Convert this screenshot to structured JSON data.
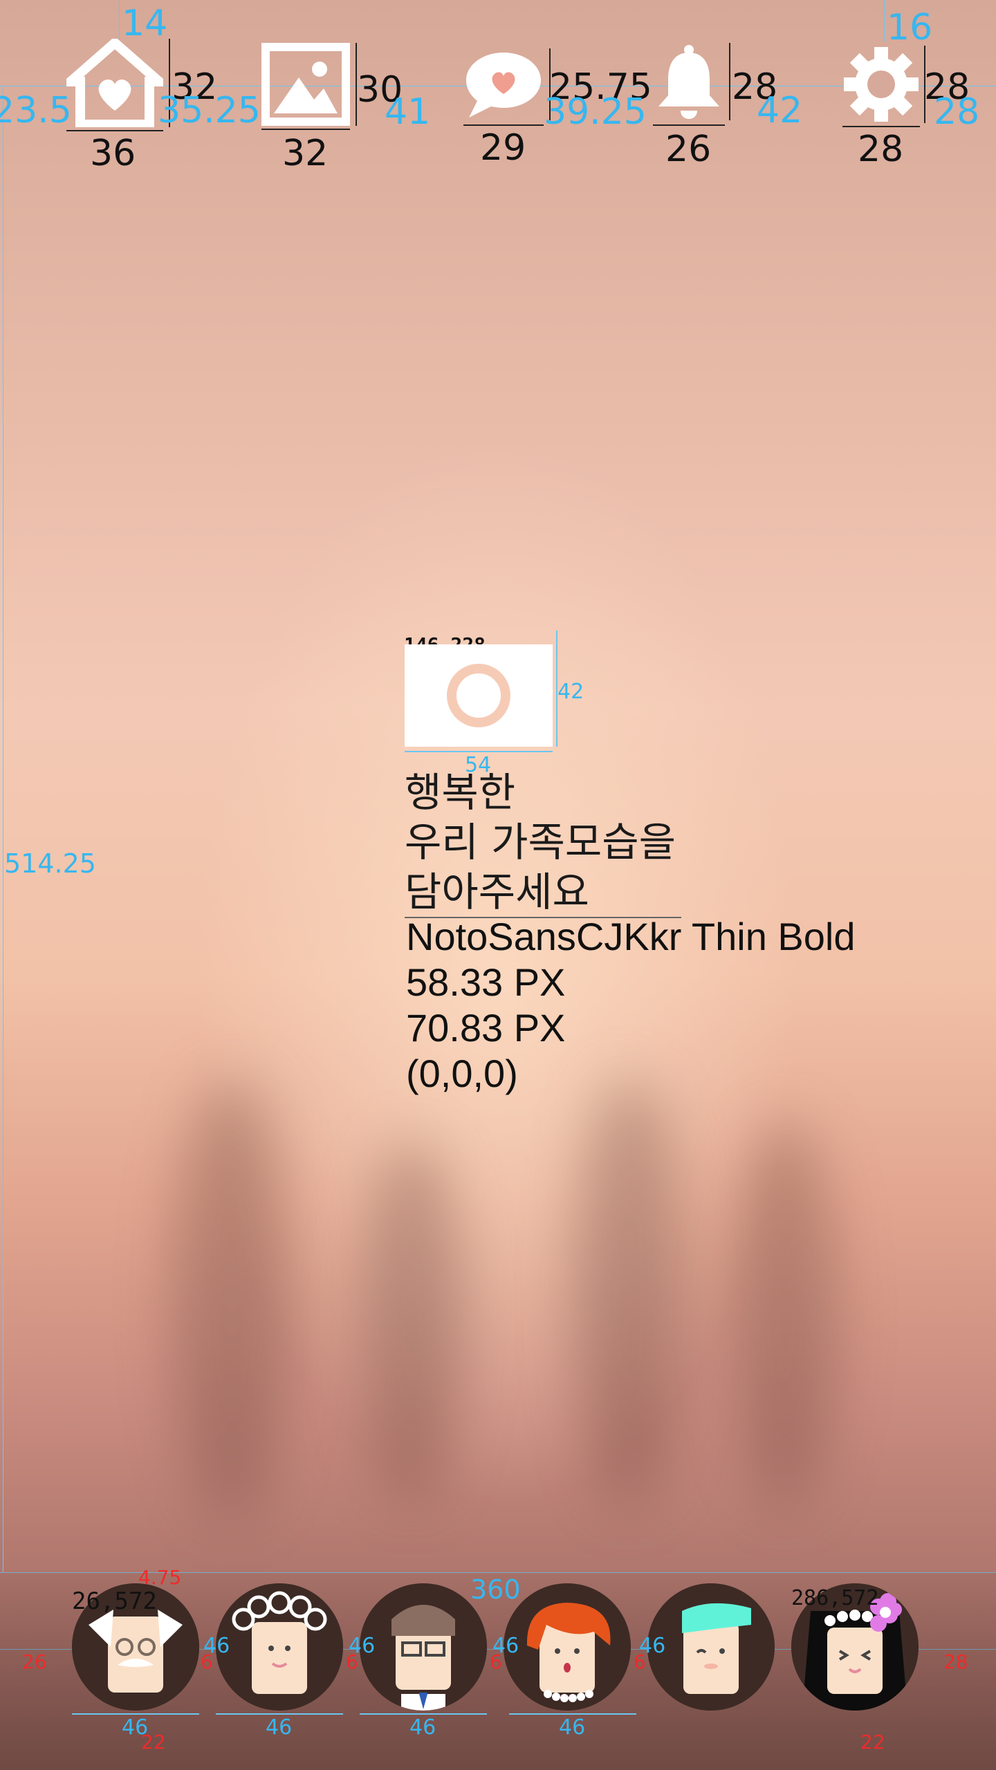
{
  "top_icons": [
    {
      "id": "home",
      "icon": "home-heart-icon",
      "width_label": "36",
      "height_label": "32",
      "gap_label": "35.25"
    },
    {
      "id": "gallery",
      "icon": "image-icon",
      "width_label": "32",
      "height_label": "30",
      "gap_label": "41"
    },
    {
      "id": "message",
      "icon": "chat-heart-icon",
      "width_label": "29",
      "height_label": "25.75",
      "gap_label": "39.25"
    },
    {
      "id": "notifications",
      "icon": "bell-icon",
      "width_label": "26",
      "height_label": "28",
      "gap_label": "42"
    },
    {
      "id": "settings",
      "icon": "gear-icon",
      "width_label": "28",
      "height_label": "28",
      "gap_label": "28"
    }
  ],
  "top_margins": {
    "left": "23.5",
    "top_left": "14",
    "top_right": "16"
  },
  "camera": {
    "icon": "camera-icon",
    "coord_label": "146,228",
    "width_label": "54",
    "height_label": "42",
    "color": "#f6cbb5"
  },
  "prompt": {
    "lines": [
      "행복한",
      "우리 가족모습을",
      "담아주세요"
    ],
    "left_offset_label": "514.25"
  },
  "font_spec": {
    "font": "NotoSansCJKkr Thin Bold",
    "size": "58.33 PX",
    "line_height": "70.83 PX",
    "color": "(0,0,0)"
  },
  "bottom_bar": {
    "width_label": "360",
    "left_coord": "26,572",
    "right_coord": "286,572",
    "top_offset_label": "4.75",
    "left_margin_label": "26",
    "right_margin_label": "28",
    "bottom_label": "22",
    "gap_label": "6",
    "avatar_size_label": "46",
    "avatars": [
      {
        "name": "grandfather",
        "icon": "grandfather-avatar-icon"
      },
      {
        "name": "grandmother",
        "icon": "grandmother-avatar-icon"
      },
      {
        "name": "father",
        "icon": "father-avatar-icon"
      },
      {
        "name": "mother",
        "icon": "mother-avatar-icon"
      },
      {
        "name": "son",
        "icon": "son-avatar-icon"
      },
      {
        "name": "daughter",
        "icon": "daughter-avatar-icon"
      }
    ]
  },
  "colors": {
    "spec_blue": "#36b7f0",
    "spec_red": "#ee2b2b",
    "avatar_bg": "#3d2a25"
  }
}
